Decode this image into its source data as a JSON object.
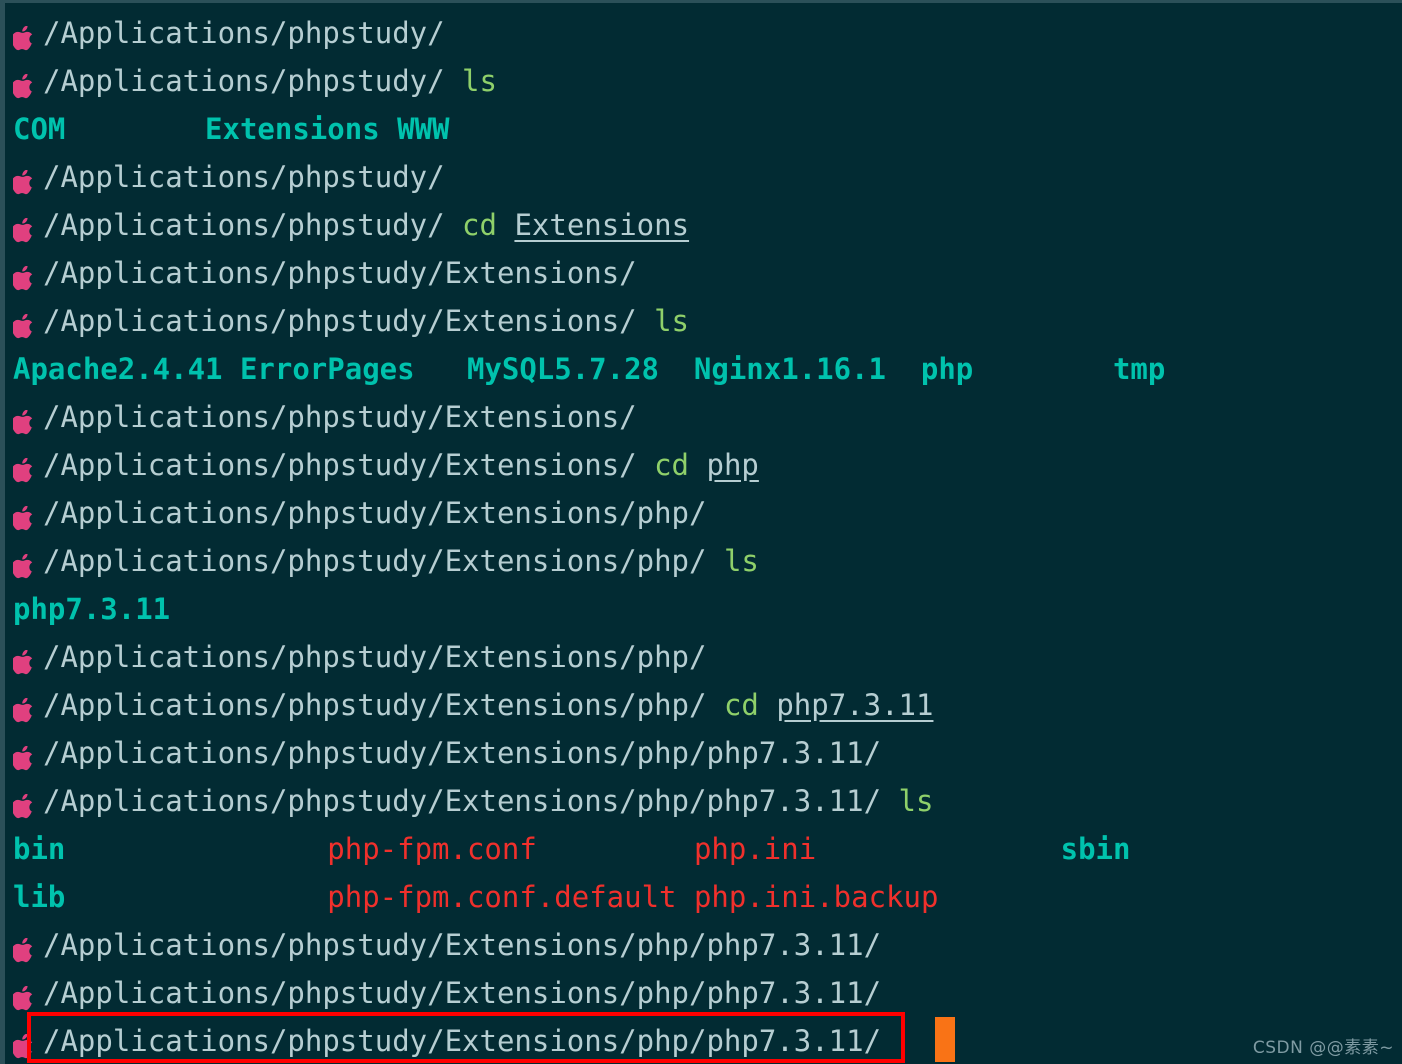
{
  "terminal": {
    "title": "macOS terminal session - phpstudy directory navigation",
    "background_color": "#022b33",
    "default_text_color": "#b6ced2",
    "prompt_icon": "apple-logo-icon",
    "prompt_icon_color": "#e0407f",
    "command_color": "#8fd06a",
    "directory_color": "#00c2ad",
    "file_color": "#f0302c",
    "cursor_color": "#f97316",
    "annotation_color": "#ff0000",
    "cursor_symbol": "block-cursor",
    "lines": [
      {
        "id": 0,
        "type": "prompt",
        "path": "/Applications/phpstudy/",
        "command": "",
        "arg": ""
      },
      {
        "id": 1,
        "type": "prompt",
        "path": "/Applications/phpstudy/",
        "command": "ls",
        "arg": ""
      },
      {
        "id": 2,
        "type": "output",
        "text": "COM        Extensions WWW"
      },
      {
        "id": 3,
        "type": "prompt",
        "path": "/Applications/phpstudy/",
        "command": "",
        "arg": ""
      },
      {
        "id": 4,
        "type": "prompt",
        "path": "/Applications/phpstudy/",
        "command": "cd",
        "arg": "Extensions"
      },
      {
        "id": 5,
        "type": "prompt",
        "path": "/Applications/phpstudy/Extensions/",
        "command": "",
        "arg": ""
      },
      {
        "id": 6,
        "type": "prompt",
        "path": "/Applications/phpstudy/Extensions/",
        "command": "ls",
        "arg": ""
      },
      {
        "id": 7,
        "type": "output",
        "text": "Apache2.4.41 ErrorPages   MySQL5.7.28  Nginx1.16.1  php        tmp"
      },
      {
        "id": 8,
        "type": "prompt",
        "path": "/Applications/phpstudy/Extensions/",
        "command": "",
        "arg": ""
      },
      {
        "id": 9,
        "type": "prompt",
        "path": "/Applications/phpstudy/Extensions/",
        "command": "cd",
        "arg": "php"
      },
      {
        "id": 10,
        "type": "prompt",
        "path": "/Applications/phpstudy/Extensions/php/",
        "command": "",
        "arg": ""
      },
      {
        "id": 11,
        "type": "prompt",
        "path": "/Applications/phpstudy/Extensions/php/",
        "command": "ls",
        "arg": ""
      },
      {
        "id": 12,
        "type": "output",
        "text": "php7.3.11"
      },
      {
        "id": 13,
        "type": "prompt",
        "path": "/Applications/phpstudy/Extensions/php/",
        "command": "",
        "arg": ""
      },
      {
        "id": 14,
        "type": "prompt",
        "path": "/Applications/phpstudy/Extensions/php/",
        "command": "cd",
        "arg": "php7.3.11"
      },
      {
        "id": 15,
        "type": "prompt",
        "path": "/Applications/phpstudy/Extensions/php/php7.3.11/",
        "command": "",
        "arg": ""
      },
      {
        "id": 16,
        "type": "prompt",
        "path": "/Applications/phpstudy/Extensions/php/php7.3.11/",
        "command": "ls",
        "arg": ""
      },
      {
        "id": 17,
        "type": "output-mixed",
        "segments": [
          {
            "text": "bin",
            "kind": "dir"
          },
          {
            "text": "               ",
            "kind": "gap"
          },
          {
            "text": "php-fpm.conf",
            "kind": "file"
          },
          {
            "text": "         ",
            "kind": "gap"
          },
          {
            "text": "php.ini",
            "kind": "file"
          },
          {
            "text": "              ",
            "kind": "gap"
          },
          {
            "text": "sbin",
            "kind": "dir"
          }
        ]
      },
      {
        "id": 18,
        "type": "output-mixed",
        "segments": [
          {
            "text": "lib",
            "kind": "dir"
          },
          {
            "text": "               ",
            "kind": "gap"
          },
          {
            "text": "php-fpm.conf.default",
            "kind": "file"
          },
          {
            "text": " ",
            "kind": "gap"
          },
          {
            "text": "php.ini.backup",
            "kind": "file"
          }
        ]
      },
      {
        "id": 19,
        "type": "prompt",
        "path": "/Applications/phpstudy/Extensions/php/php7.3.11/",
        "command": "",
        "arg": ""
      },
      {
        "id": 20,
        "type": "prompt",
        "path": "/Applications/phpstudy/Extensions/php/php7.3.11/",
        "command": "",
        "arg": ""
      },
      {
        "id": 21,
        "type": "prompt",
        "path": "/Applications/phpstudy/Extensions/php/php7.3.11/",
        "command": "",
        "arg": "",
        "highlighted": true,
        "cursor": true
      }
    ]
  },
  "watermark": {
    "text": "CSDN @@素素~"
  }
}
